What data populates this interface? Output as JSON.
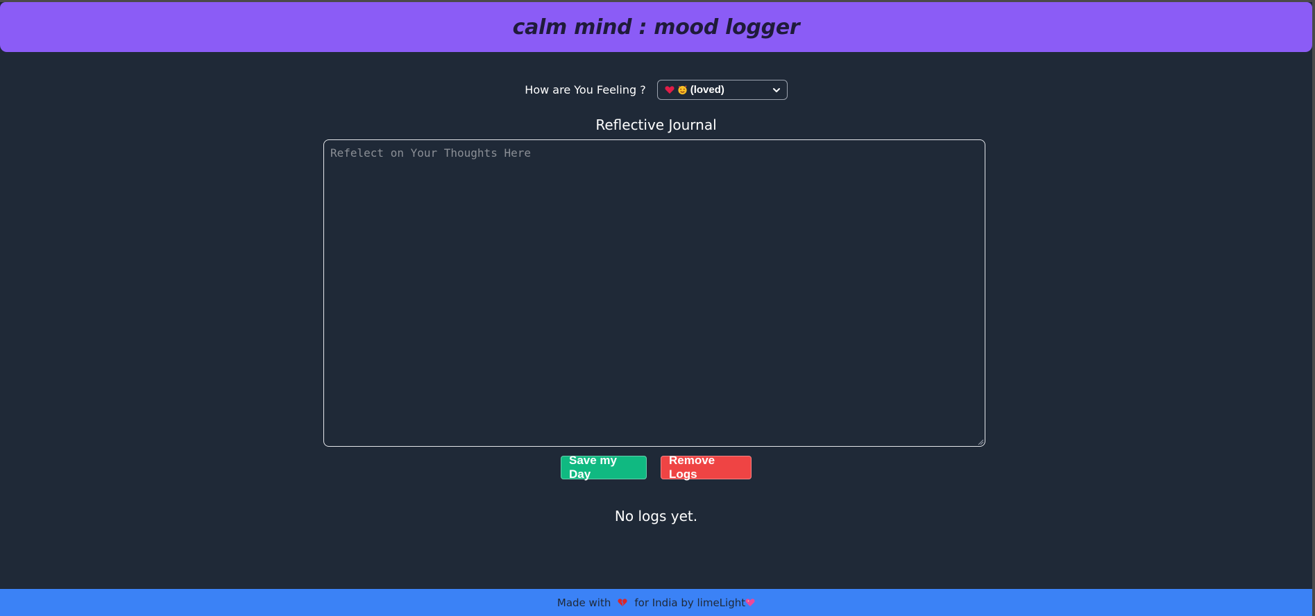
{
  "header": {
    "title": "calm mind : mood logger"
  },
  "mood": {
    "label": "How are You Feeling ?",
    "selected": "(loved)",
    "icons": [
      "heart-icon",
      "smiling-face-with-hearts-icon"
    ]
  },
  "journal": {
    "title": "Reflective Journal",
    "placeholder": "Refelect on Your Thoughts Here",
    "value": ""
  },
  "actions": {
    "save_label": "Save my Day",
    "remove_label": "Remove Logs"
  },
  "logs": {
    "empty_text": "No logs yet."
  },
  "footer": {
    "made_with": "Made with",
    "middle": "for India by limeLight"
  },
  "colors": {
    "header_bg": "#8b5cf6",
    "page_bg": "#1f2937",
    "save_bg": "#10b981",
    "remove_bg": "#ef4444",
    "footer_bg": "#3b82f6"
  }
}
